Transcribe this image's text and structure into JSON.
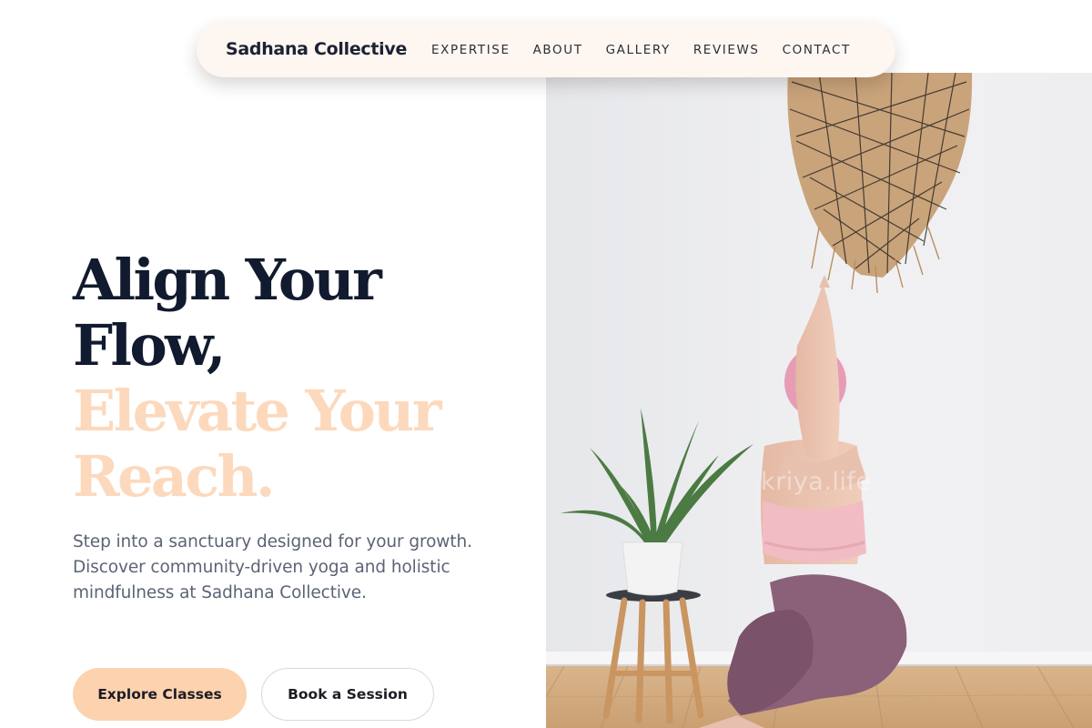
{
  "nav": {
    "brand": "Sadhana Collective",
    "links": [
      "EXPERTISE",
      "ABOUT",
      "GALLERY",
      "REVIEWS",
      "CONTACT"
    ]
  },
  "hero": {
    "headline_line1": "Align Your",
    "headline_line2": "Flow,",
    "headline_line3": "Elevate Your",
    "headline_line4": "Reach.",
    "description": "Step into a sanctuary designed for your growth. Discover community-driven yoga and holistic mindfulness at Sadhana Collective.",
    "primary_cta": "Explore Classes",
    "secondary_cta": "Book a Session",
    "image_watermark": "kriya.life"
  },
  "colors": {
    "heading_dark": "#111a2e",
    "heading_accent": "#fcd9bd",
    "primary_button": "#fcd2af",
    "nav_background": "#fdf6f1"
  },
  "icons": [
    "woven-pendant-lamp",
    "aloe-plant",
    "wooden-stool",
    "yoga-practitioner"
  ]
}
